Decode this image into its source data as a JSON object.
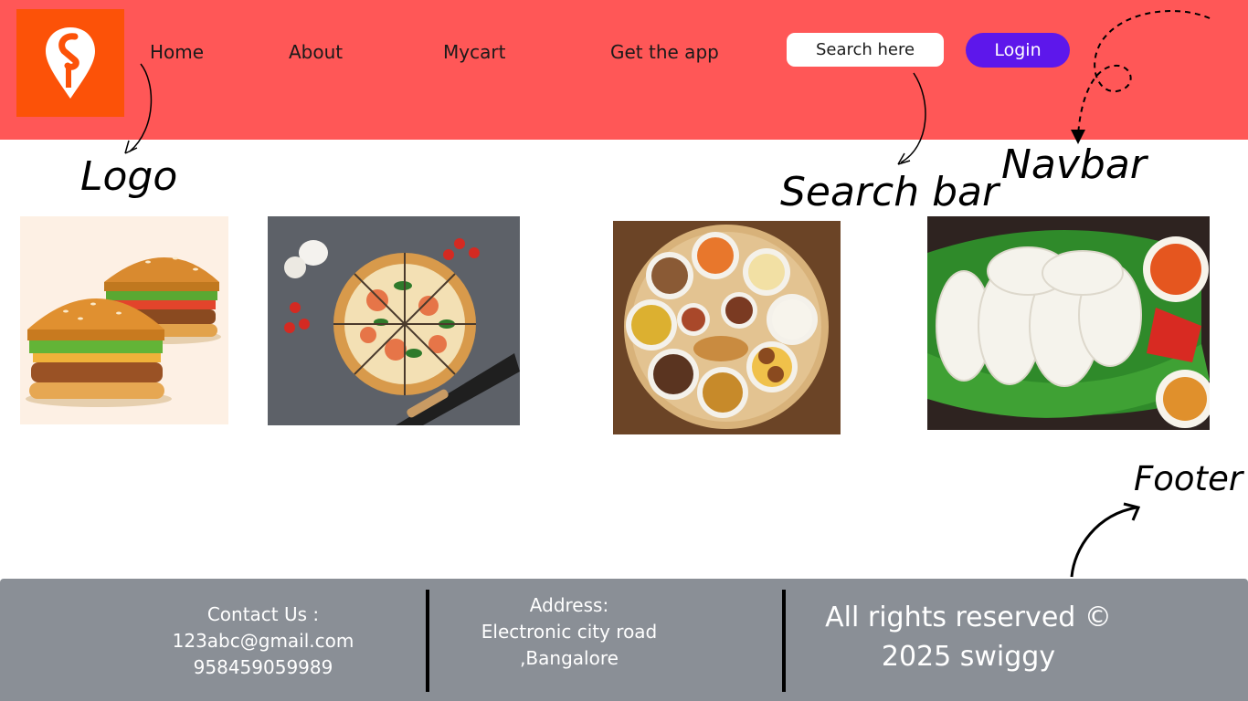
{
  "navbar": {
    "links": [
      "Home",
      "About",
      "Mycart",
      "Get the app"
    ],
    "search_placeholder": "Search here",
    "login_label": "Login",
    "logo": "swiggy-logo",
    "colors": {
      "background": "#ff5757",
      "logo_bg": "#fc5208",
      "login_bg": "#5d17eb"
    }
  },
  "annotations": {
    "logo": "Logo",
    "search_bar": "Search bar",
    "navbar": "Navbar",
    "footer": "Footer"
  },
  "foods": [
    "burgers",
    "pizza",
    "thali",
    "idli"
  ],
  "footer": {
    "contact": {
      "title": "Contact Us :",
      "email": "123abc@gmail.com",
      "phone": "958459059989"
    },
    "address": {
      "title": "Address:",
      "line1": "Electronic city road",
      "line2": ",Bangalore"
    },
    "rights": {
      "line1": "All rights reserved ©",
      "line2": "2025 swiggy"
    },
    "colors": {
      "background": "#8a8f96"
    }
  }
}
